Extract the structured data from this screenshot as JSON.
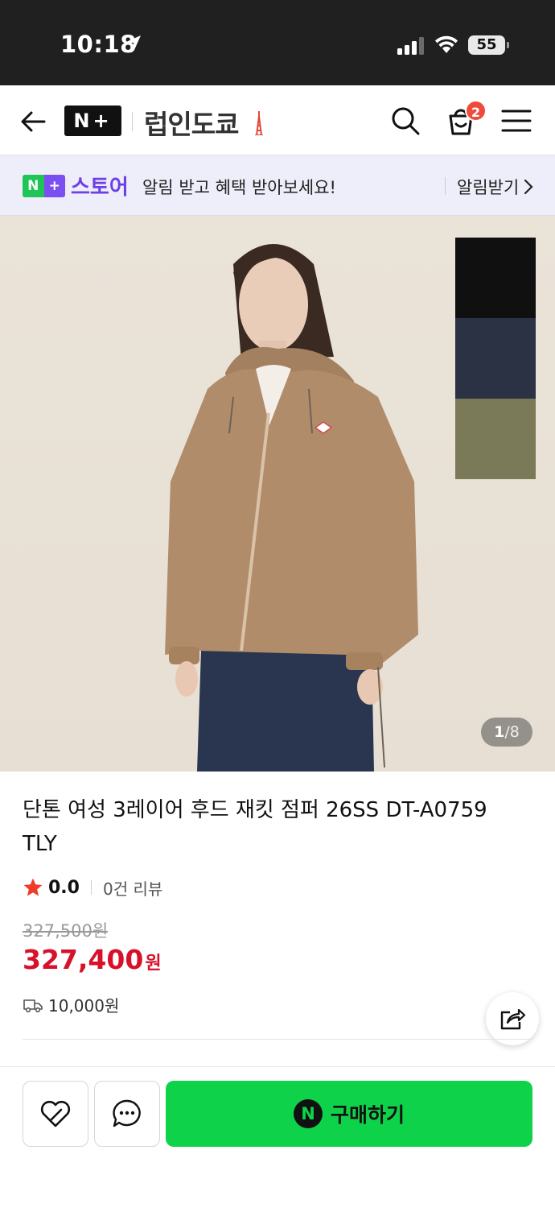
{
  "status_bar": {
    "time": "10:18",
    "battery": "55"
  },
  "header": {
    "logo_text": "N+",
    "store_name": "럽인도쿄",
    "cart_count": "2"
  },
  "promo": {
    "badge": "N+",
    "brand": "스토어",
    "message": "알림 받고 혜택 받아보세요!",
    "action_label": "알림받기"
  },
  "gallery": {
    "current": "1",
    "total": "/8",
    "swatch_colors": [
      "#101010",
      "#2b3244",
      "#7b7a58"
    ]
  },
  "product": {
    "title": "단톤 여성 3레이어 후드 재킷 점퍼 26SS DT-A0759 TLY",
    "rating": "0.0",
    "review_count": "0건 리뷰",
    "original_price": "327,500원",
    "sale_price": "327,400",
    "sale_unit": "원",
    "shipping_fee": "10,000원"
  },
  "bottom_bar": {
    "buy_label": "구매하기"
  },
  "colors": {
    "accent_green": "#0ed34a",
    "price_red": "#d8102a",
    "cart_badge": "#f04a3a",
    "brand_purple": "#6c3fe8"
  }
}
